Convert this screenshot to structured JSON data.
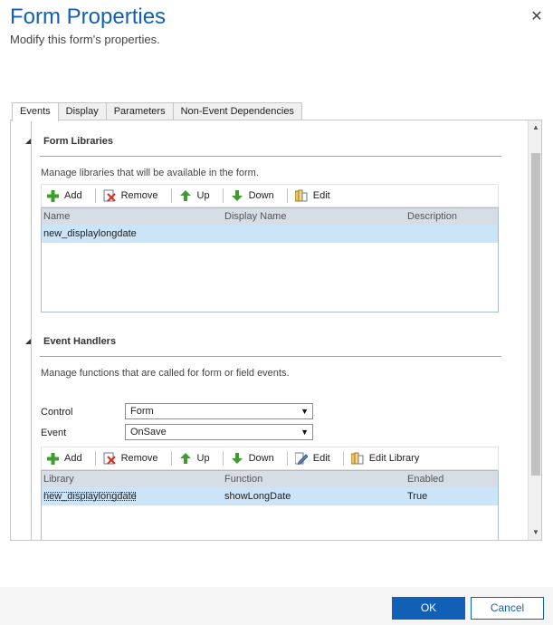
{
  "dialog": {
    "title": "Form Properties",
    "subtitle": "Modify this form's properties.",
    "close_glyph": "✕"
  },
  "tabs": [
    {
      "label": "Events",
      "active": true
    },
    {
      "label": "Display",
      "active": false
    },
    {
      "label": "Parameters",
      "active": false
    },
    {
      "label": "Non-Event Dependencies",
      "active": false
    }
  ],
  "form_libraries": {
    "header": "Form Libraries",
    "description": "Manage libraries that will be available in the form.",
    "toolbar": {
      "add": "Add",
      "remove": "Remove",
      "up": "Up",
      "down": "Down",
      "edit": "Edit"
    },
    "columns": [
      "Name",
      "Display Name",
      "Description"
    ],
    "rows": [
      {
        "name": "new_displaylongdate",
        "display_name": "",
        "description": ""
      }
    ]
  },
  "event_handlers": {
    "header": "Event Handlers",
    "description": "Manage functions that are called for form or field events.",
    "control_label": "Control",
    "control_value": "Form",
    "event_label": "Event",
    "event_value": "OnSave",
    "toolbar": {
      "add": "Add",
      "remove": "Remove",
      "up": "Up",
      "down": "Down",
      "edit": "Edit",
      "edit_library": "Edit Library"
    },
    "columns": [
      "Library",
      "Function",
      "Enabled"
    ],
    "rows": [
      {
        "library": "new_displaylongdate",
        "function": "showLongDate",
        "enabled": "True"
      }
    ]
  },
  "footer": {
    "ok": "OK",
    "cancel": "Cancel"
  },
  "colors": {
    "accent": "#1160b7",
    "selection": "#cce4f7",
    "grid_header": "#d7dde4"
  }
}
